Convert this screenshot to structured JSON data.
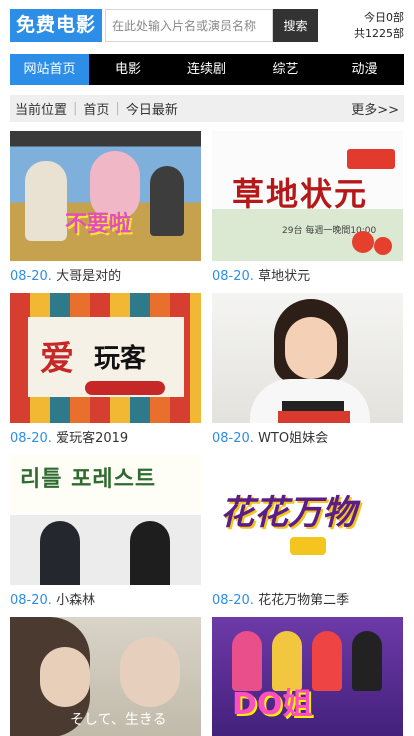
{
  "header": {
    "logo": "免费电影",
    "search_placeholder": "在此处输入片名或演员名称",
    "search_button": "搜索",
    "stats_today": "今日0部",
    "stats_total": "共1225部"
  },
  "nav": {
    "items": [
      {
        "label": "网站首页"
      },
      {
        "label": "电影"
      },
      {
        "label": "连续剧"
      },
      {
        "label": "综艺"
      },
      {
        "label": "动漫"
      }
    ]
  },
  "breadcrumb": {
    "label": "当前位置",
    "home": "首页",
    "current": "今日最新",
    "more": "更多>>"
  },
  "items": [
    {
      "date": "08-20.",
      "title": "大哥是对的",
      "art_text": "不要啦"
    },
    {
      "date": "08-20.",
      "title": "草地状元",
      "art_text": "草地状元",
      "art_sub": "29台 每週一晚間10:00"
    },
    {
      "date": "08-20.",
      "title": "爱玩客2019",
      "art_text": "爱",
      "art_text2": "玩客"
    },
    {
      "date": "08-20.",
      "title": "WTO姐妹会"
    },
    {
      "date": "08-20.",
      "title": "小森林",
      "art_text": "리틀 포레스트"
    },
    {
      "date": "08-20.",
      "title": "花花万物第二季",
      "art_text": "花花万物"
    },
    {
      "date": "",
      "title": "",
      "art_text": "そして、生きる"
    },
    {
      "date": "",
      "title": "",
      "art_text": "DO姐"
    }
  ]
}
